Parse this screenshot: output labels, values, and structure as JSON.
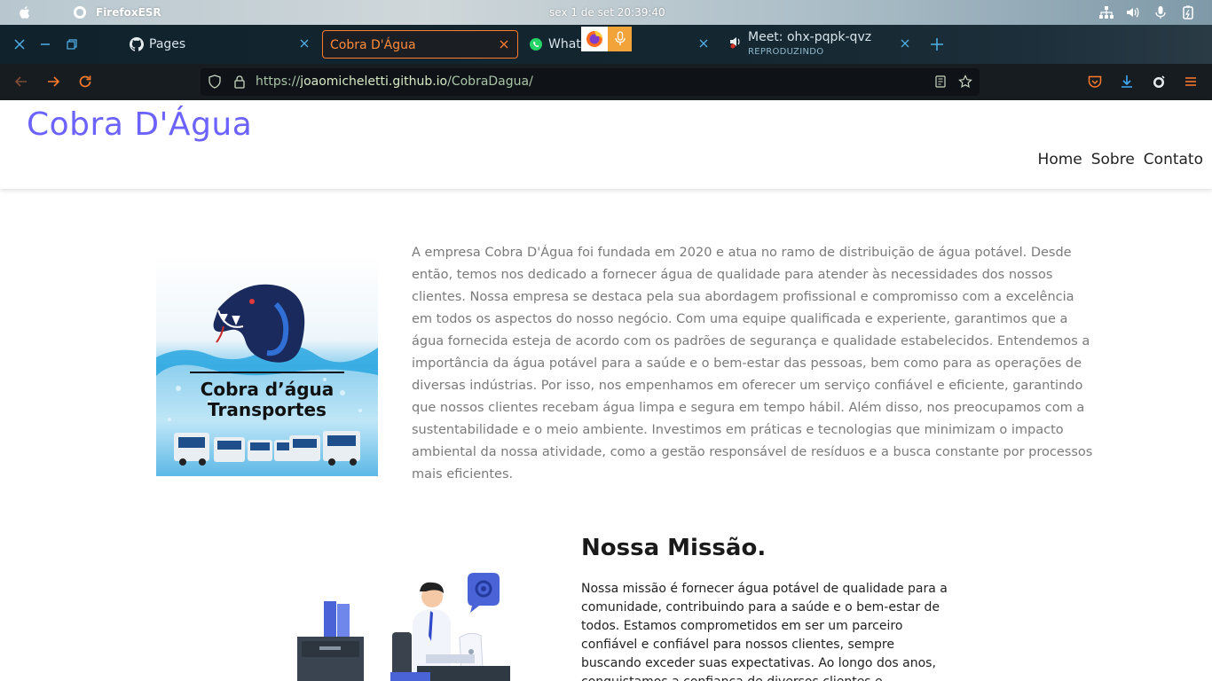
{
  "os": {
    "app_name": "FirefoxESR",
    "clock": "sex 1 de set  20:39:40"
  },
  "tabs": [
    {
      "label": "Pages",
      "icon": "github-icon"
    },
    {
      "label": "Cobra D'Água",
      "icon": "none",
      "active": true
    },
    {
      "label": "What",
      "icon": "whatsapp-icon"
    },
    {
      "label": "Meet: ohx-pqpk-qvz",
      "sub": "REPRODUZINDO",
      "icon": "meet-audio-icon"
    }
  ],
  "urlbar": {
    "url_prefix": "https://",
    "url_host": "joaomicheletti.github.io",
    "url_path": "/CobraDagua/"
  },
  "colors": {
    "brand": "#6c63ff",
    "active_tab": "#ff7a2b"
  },
  "site": {
    "brand": "Cobra D'Água",
    "menu": [
      "Home",
      "Sobre",
      "Contato"
    ],
    "logo_line1": "Cobra d’água",
    "logo_line2": "Transportes",
    "about_text": "A empresa Cobra D'Água foi fundada em 2020 e atua no ramo de distribuição de água potável. Desde então, temos nos dedicado a fornecer água de qualidade para atender às necessidades dos nossos clientes. Nossa empresa se destaca pela sua abordagem profissional e compromisso com a excelência em todos os aspectos do nosso negócio. Com uma equipe qualificada e experiente, garantimos que a água fornecida esteja de acordo com os padrões de segurança e qualidade estabelecidos. Entendemos a importância da água potável para a saúde e o bem-estar das pessoas, bem como para as operações de diversas indústrias. Por isso, nos empenhamos em oferecer um serviço confiável e eficiente, garantindo que nossos clientes recebam água limpa e segura em tempo hábil. Além disso, nos preocupamos com a sustentabilidade e o meio ambiente. Investimos em práticas e tecnologias que minimizam o impacto ambiental da nossa atividade, como a gestão responsável de resíduos e a busca constante por processos mais eficientes.",
    "mission_title": "Nossa Missão.",
    "mission_text": "Nossa missão é fornecer água potável de qualidade para a comunidade, contribuindo para a saúde e o bem-estar de todos. Estamos comprometidos em ser um parceiro confiável e confiável para nossos clientes, sempre buscando exceder suas expectativas. Ao longo dos anos, conquistamos a confiança de diversos clientes e"
  }
}
